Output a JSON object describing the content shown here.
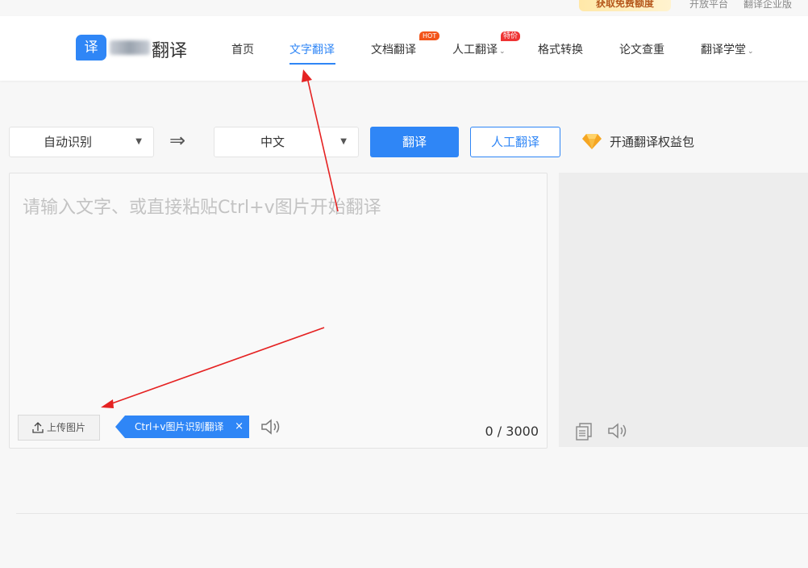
{
  "topbar": {
    "promo_label": "获取免费额度",
    "links": [
      "开放平台",
      "翻译企业版"
    ]
  },
  "header": {
    "logo_badge": "译",
    "logo_text": "翻译",
    "nav": [
      {
        "label": "首页"
      },
      {
        "label": "文字翻译",
        "active": true
      },
      {
        "label": "文档翻译",
        "badge": "HOT"
      },
      {
        "label": "人工翻译",
        "badge": "特价",
        "has_dropdown": true
      },
      {
        "label": "格式转换"
      },
      {
        "label": "论文查重"
      },
      {
        "label": "翻译学堂",
        "has_dropdown": true
      }
    ]
  },
  "controls": {
    "source_lang": "自动识别",
    "target_lang": "中文",
    "swap_icon": "⇒",
    "translate_button": "翻译",
    "human_button": "人工翻译",
    "vip_label": "开通翻译权益包"
  },
  "input": {
    "placeholder": "请输入文字、或直接粘贴Ctrl+v图片开始翻译",
    "upload_label": "上传图片",
    "ocr_tag_label": "Ctrl+v图片识别翻译",
    "ocr_tag_close": "×",
    "count": "0",
    "count_max": "3000",
    "count_sep": " / "
  },
  "colors": {
    "accent": "#2f86f6",
    "hot": "#f2541b",
    "sale": "#e33333",
    "annotation": "#e52222",
    "gem": "#f5a623"
  },
  "icons": {
    "upload": "upload-icon",
    "speaker": "speaker-icon",
    "copy": "copy-icon",
    "gem": "diamond-icon",
    "swap": "swap-arrow-icon"
  }
}
